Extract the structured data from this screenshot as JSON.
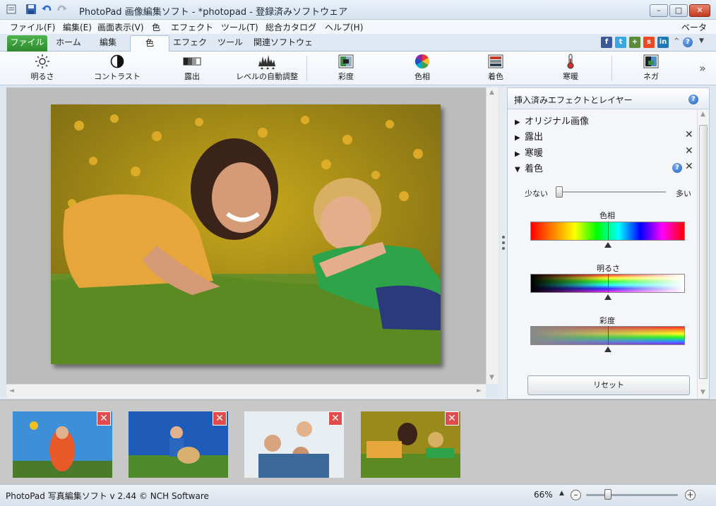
{
  "window": {
    "title": "PhotoPad 画像編集ソフト - *photopad - 登録済みソフトウェア",
    "controls": {
      "minimize": "–",
      "maximize": "□",
      "close": "✕"
    }
  },
  "menu": {
    "items": [
      "ファイル(F)",
      "編集(E)",
      "画面表示(V)",
      "色",
      "エフェクト",
      "ツール(T)",
      "総合カタログ",
      "ヘルプ(H)"
    ],
    "beta": "ベータ"
  },
  "tabs": {
    "items": [
      "ファイル",
      "ホーム",
      "編集",
      "色",
      "エフェクト",
      "ツール",
      "関連ソフトウェア"
    ],
    "active": "色"
  },
  "social": [
    {
      "name": "facebook-icon",
      "glyph": "f",
      "color": "#3b5998"
    },
    {
      "name": "twitter-icon",
      "glyph": "t",
      "color": "#3aa7e0"
    },
    {
      "name": "googleplus-icon",
      "glyph": "+",
      "color": "#5a8a3a"
    },
    {
      "name": "stumbleupon-icon",
      "glyph": "s",
      "color": "#eb4924"
    },
    {
      "name": "linkedin-icon",
      "glyph": "in",
      "color": "#1f76b6"
    }
  ],
  "ribbon": {
    "items": [
      "明るさ",
      "コントラスト",
      "露出",
      "レベルの自動調整",
      "彩度",
      "色相",
      "着色",
      "寒暖",
      "ネガ"
    ],
    "more": "»"
  },
  "panel": {
    "title": "挿入済みエフェクトとレイヤー",
    "layers": [
      {
        "label": "オリジナル画像",
        "expanded": false
      },
      {
        "label": "露出",
        "expanded": false
      },
      {
        "label": "寒暖",
        "expanded": false
      },
      {
        "label": "着色",
        "expanded": true
      }
    ],
    "amount": {
      "low": "少ない",
      "high": "多い",
      "value": 0.0
    },
    "sliders": [
      {
        "label": "色相",
        "value": 0.5
      },
      {
        "label": "明るさ",
        "value": 0.5
      },
      {
        "label": "彩度",
        "value": 0.5
      }
    ],
    "reset": "リセット"
  },
  "filmstrip": {
    "count": 4,
    "delete_glyph": "✕"
  },
  "status": {
    "text": "PhotoPad 写真編集ソフト v 2.44 © NCH Software",
    "zoom": "66%",
    "zoom_value": 0.2
  }
}
